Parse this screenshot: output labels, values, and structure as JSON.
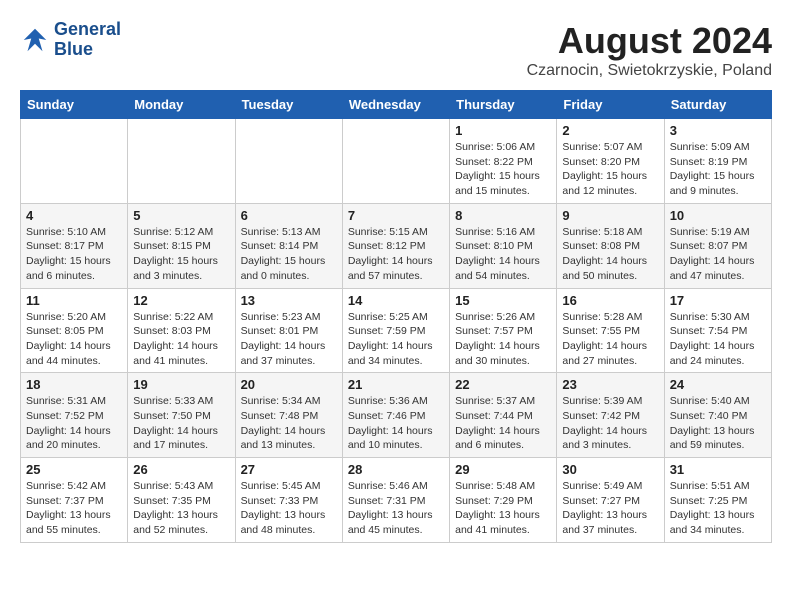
{
  "logo": {
    "line1": "General",
    "line2": "Blue"
  },
  "title": "August 2024",
  "location": "Czarnocin, Swietokrzyskie, Poland",
  "days_of_week": [
    "Sunday",
    "Monday",
    "Tuesday",
    "Wednesday",
    "Thursday",
    "Friday",
    "Saturday"
  ],
  "weeks": [
    [
      {
        "day": "",
        "detail": ""
      },
      {
        "day": "",
        "detail": ""
      },
      {
        "day": "",
        "detail": ""
      },
      {
        "day": "",
        "detail": ""
      },
      {
        "day": "1",
        "detail": "Sunrise: 5:06 AM\nSunset: 8:22 PM\nDaylight: 15 hours\nand 15 minutes."
      },
      {
        "day": "2",
        "detail": "Sunrise: 5:07 AM\nSunset: 8:20 PM\nDaylight: 15 hours\nand 12 minutes."
      },
      {
        "day": "3",
        "detail": "Sunrise: 5:09 AM\nSunset: 8:19 PM\nDaylight: 15 hours\nand 9 minutes."
      }
    ],
    [
      {
        "day": "4",
        "detail": "Sunrise: 5:10 AM\nSunset: 8:17 PM\nDaylight: 15 hours\nand 6 minutes."
      },
      {
        "day": "5",
        "detail": "Sunrise: 5:12 AM\nSunset: 8:15 PM\nDaylight: 15 hours\nand 3 minutes."
      },
      {
        "day": "6",
        "detail": "Sunrise: 5:13 AM\nSunset: 8:14 PM\nDaylight: 15 hours\nand 0 minutes."
      },
      {
        "day": "7",
        "detail": "Sunrise: 5:15 AM\nSunset: 8:12 PM\nDaylight: 14 hours\nand 57 minutes."
      },
      {
        "day": "8",
        "detail": "Sunrise: 5:16 AM\nSunset: 8:10 PM\nDaylight: 14 hours\nand 54 minutes."
      },
      {
        "day": "9",
        "detail": "Sunrise: 5:18 AM\nSunset: 8:08 PM\nDaylight: 14 hours\nand 50 minutes."
      },
      {
        "day": "10",
        "detail": "Sunrise: 5:19 AM\nSunset: 8:07 PM\nDaylight: 14 hours\nand 47 minutes."
      }
    ],
    [
      {
        "day": "11",
        "detail": "Sunrise: 5:20 AM\nSunset: 8:05 PM\nDaylight: 14 hours\nand 44 minutes."
      },
      {
        "day": "12",
        "detail": "Sunrise: 5:22 AM\nSunset: 8:03 PM\nDaylight: 14 hours\nand 41 minutes."
      },
      {
        "day": "13",
        "detail": "Sunrise: 5:23 AM\nSunset: 8:01 PM\nDaylight: 14 hours\nand 37 minutes."
      },
      {
        "day": "14",
        "detail": "Sunrise: 5:25 AM\nSunset: 7:59 PM\nDaylight: 14 hours\nand 34 minutes."
      },
      {
        "day": "15",
        "detail": "Sunrise: 5:26 AM\nSunset: 7:57 PM\nDaylight: 14 hours\nand 30 minutes."
      },
      {
        "day": "16",
        "detail": "Sunrise: 5:28 AM\nSunset: 7:55 PM\nDaylight: 14 hours\nand 27 minutes."
      },
      {
        "day": "17",
        "detail": "Sunrise: 5:30 AM\nSunset: 7:54 PM\nDaylight: 14 hours\nand 24 minutes."
      }
    ],
    [
      {
        "day": "18",
        "detail": "Sunrise: 5:31 AM\nSunset: 7:52 PM\nDaylight: 14 hours\nand 20 minutes."
      },
      {
        "day": "19",
        "detail": "Sunrise: 5:33 AM\nSunset: 7:50 PM\nDaylight: 14 hours\nand 17 minutes."
      },
      {
        "day": "20",
        "detail": "Sunrise: 5:34 AM\nSunset: 7:48 PM\nDaylight: 14 hours\nand 13 minutes."
      },
      {
        "day": "21",
        "detail": "Sunrise: 5:36 AM\nSunset: 7:46 PM\nDaylight: 14 hours\nand 10 minutes."
      },
      {
        "day": "22",
        "detail": "Sunrise: 5:37 AM\nSunset: 7:44 PM\nDaylight: 14 hours\nand 6 minutes."
      },
      {
        "day": "23",
        "detail": "Sunrise: 5:39 AM\nSunset: 7:42 PM\nDaylight: 14 hours\nand 3 minutes."
      },
      {
        "day": "24",
        "detail": "Sunrise: 5:40 AM\nSunset: 7:40 PM\nDaylight: 13 hours\nand 59 minutes."
      }
    ],
    [
      {
        "day": "25",
        "detail": "Sunrise: 5:42 AM\nSunset: 7:37 PM\nDaylight: 13 hours\nand 55 minutes."
      },
      {
        "day": "26",
        "detail": "Sunrise: 5:43 AM\nSunset: 7:35 PM\nDaylight: 13 hours\nand 52 minutes."
      },
      {
        "day": "27",
        "detail": "Sunrise: 5:45 AM\nSunset: 7:33 PM\nDaylight: 13 hours\nand 48 minutes."
      },
      {
        "day": "28",
        "detail": "Sunrise: 5:46 AM\nSunset: 7:31 PM\nDaylight: 13 hours\nand 45 minutes."
      },
      {
        "day": "29",
        "detail": "Sunrise: 5:48 AM\nSunset: 7:29 PM\nDaylight: 13 hours\nand 41 minutes."
      },
      {
        "day": "30",
        "detail": "Sunrise: 5:49 AM\nSunset: 7:27 PM\nDaylight: 13 hours\nand 37 minutes."
      },
      {
        "day": "31",
        "detail": "Sunrise: 5:51 AM\nSunset: 7:25 PM\nDaylight: 13 hours\nand 34 minutes."
      }
    ]
  ]
}
